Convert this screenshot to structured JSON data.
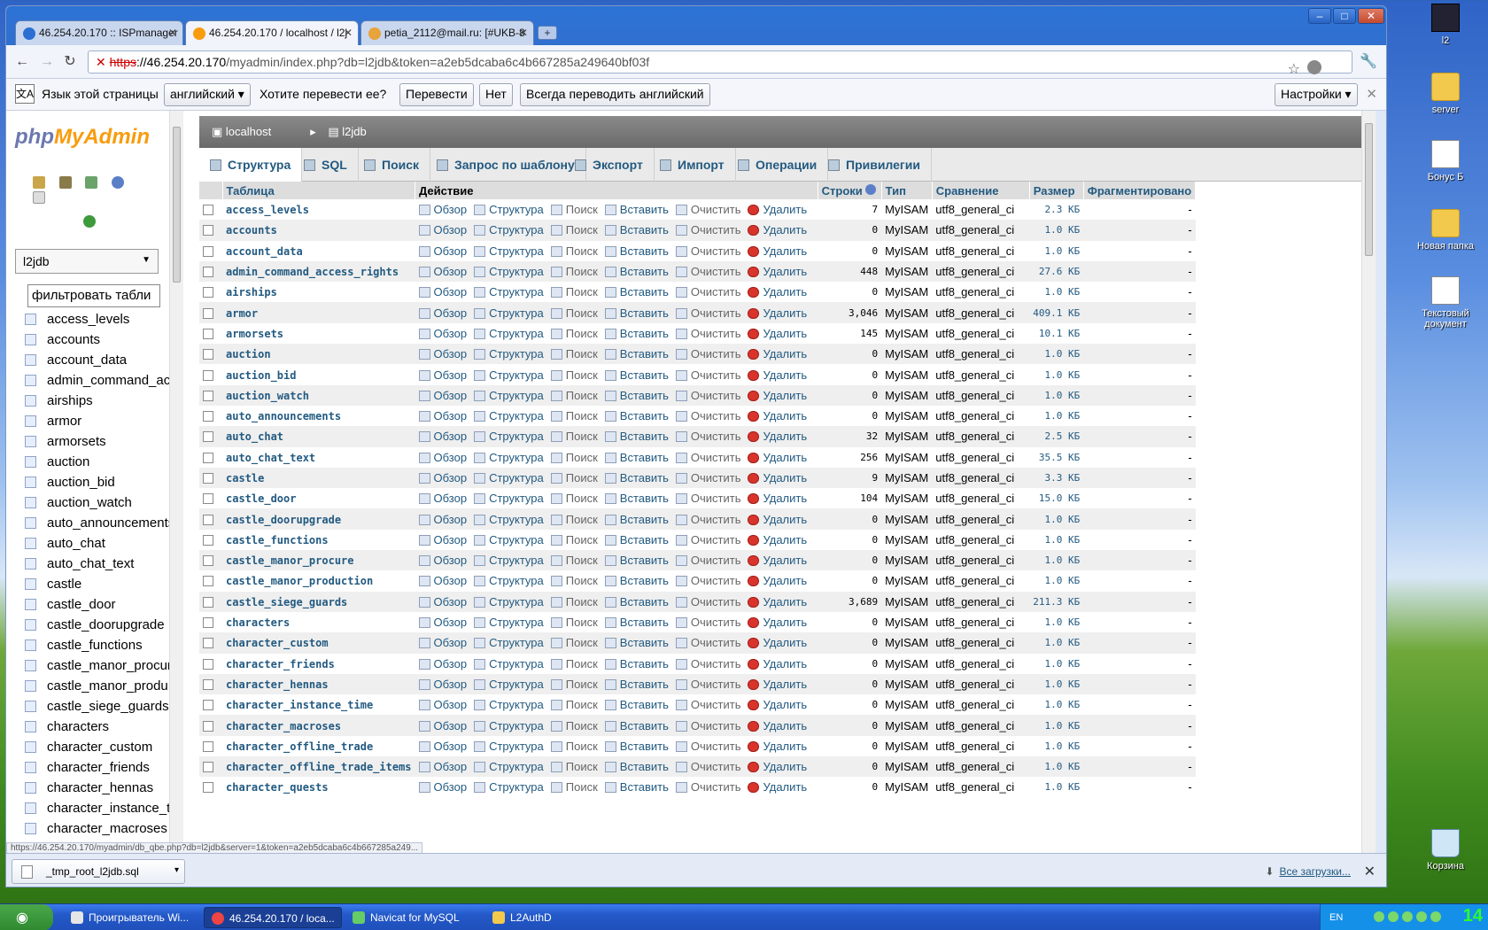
{
  "desktop": {
    "icons": [
      {
        "label": "l2",
        "icon": "l2-app-icon"
      },
      {
        "label": "server",
        "icon": "folder-icon"
      },
      {
        "label": "Бонус Б",
        "icon": "text-document-icon"
      },
      {
        "label": "Новая папка",
        "icon": "folder-icon"
      },
      {
        "label": "Текстовый документ",
        "icon": "text-document-icon"
      },
      {
        "label": "Корзина",
        "icon": "recycle-bin-icon"
      }
    ]
  },
  "browser": {
    "tabs": [
      {
        "title": "46.254.20.170 :: ISPmanager"
      },
      {
        "title": "46.254.20.170 / localhost / l2j"
      },
      {
        "title": "petia_2112@mail.ru: [#UKB-8"
      }
    ],
    "new_tab": "+",
    "url": {
      "scheme": "https",
      "host": "://46.254.20.170",
      "path": "/myadmin/index.php?db=l2jdb&token=a2eb5dcaba6c4b667285a249640bf03f"
    },
    "translate": {
      "page_lang_label": "Язык этой страницы",
      "lang_value": "английский",
      "question": "Хотите перевести ее?",
      "translate_btn": "Перевести",
      "no_btn": "Нет",
      "always_btn": "Всегда переводить английский",
      "settings_btn": "Настройки"
    },
    "status_url": "https://46.254.20.170/myadmin/db_qbe.php?db=l2jdb&server=1&token=a2eb5dcaba6c4b667285a249...",
    "download": {
      "file": "_tmp_root_l2jdb.sql",
      "all_link": "Все загрузки..."
    }
  },
  "pma": {
    "logo_php": "php",
    "logo_myadmin": "MyAdmin",
    "db_select": "l2jdb",
    "filter_placeholder": "фильтровать табли",
    "breadcrumb": {
      "server": "localhost",
      "db": "l2jdb"
    },
    "tabs": [
      {
        "label": "Структура",
        "icon": "structure-icon"
      },
      {
        "label": "SQL",
        "icon": "sql-icon"
      },
      {
        "label": "Поиск",
        "icon": "search-icon"
      },
      {
        "label": "Запрос по шаблону",
        "icon": "query-icon"
      },
      {
        "label": "Экспорт",
        "icon": "export-icon"
      },
      {
        "label": "Импорт",
        "icon": "import-icon"
      },
      {
        "label": "Операции",
        "icon": "operations-icon"
      },
      {
        "label": "Привилегии",
        "icon": "privileges-icon"
      }
    ],
    "headers": {
      "table": "Таблица",
      "action": "Действие",
      "rows": "Строки",
      "type": "Тип",
      "collation": "Сравнение",
      "size": "Размер",
      "overhead": "Фрагментировано"
    },
    "actions": {
      "browse": "Обзор",
      "structure": "Структура",
      "search": "Поиск",
      "insert": "Вставить",
      "empty": "Очистить",
      "drop": "Удалить"
    },
    "sidebar_tables": [
      "access_levels",
      "accounts",
      "account_data",
      "admin_command_ac",
      "airships",
      "armor",
      "armorsets",
      "auction",
      "auction_bid",
      "auction_watch",
      "auto_announcements",
      "auto_chat",
      "auto_chat_text",
      "castle",
      "castle_door",
      "castle_doorupgrade",
      "castle_functions",
      "castle_manor_procur",
      "castle_manor_produ",
      "castle_siege_guards",
      "characters",
      "character_custom",
      "character_friends",
      "character_hennas",
      "character_instance_t",
      "character_macroses"
    ],
    "rows": [
      {
        "name": "access_levels",
        "rows": "7",
        "type": "MyISAM",
        "coll": "utf8_general_ci",
        "size": "2.3",
        "unit": "КБ",
        "over": "-"
      },
      {
        "name": "accounts",
        "rows": "0",
        "type": "MyISAM",
        "coll": "utf8_general_ci",
        "size": "1.0",
        "unit": "КБ",
        "over": "-"
      },
      {
        "name": "account_data",
        "rows": "0",
        "type": "MyISAM",
        "coll": "utf8_general_ci",
        "size": "1.0",
        "unit": "КБ",
        "over": "-"
      },
      {
        "name": "admin_command_access_rights",
        "rows": "448",
        "type": "MyISAM",
        "coll": "utf8_general_ci",
        "size": "27.6",
        "unit": "КБ",
        "over": "-"
      },
      {
        "name": "airships",
        "rows": "0",
        "type": "MyISAM",
        "coll": "utf8_general_ci",
        "size": "1.0",
        "unit": "КБ",
        "over": "-"
      },
      {
        "name": "armor",
        "rows": "3,046",
        "type": "MyISAM",
        "coll": "utf8_general_ci",
        "size": "409.1",
        "unit": "КБ",
        "over": "-"
      },
      {
        "name": "armorsets",
        "rows": "145",
        "type": "MyISAM",
        "coll": "utf8_general_ci",
        "size": "10.1",
        "unit": "КБ",
        "over": "-"
      },
      {
        "name": "auction",
        "rows": "0",
        "type": "MyISAM",
        "coll": "utf8_general_ci",
        "size": "1.0",
        "unit": "КБ",
        "over": "-"
      },
      {
        "name": "auction_bid",
        "rows": "0",
        "type": "MyISAM",
        "coll": "utf8_general_ci",
        "size": "1.0",
        "unit": "КБ",
        "over": "-"
      },
      {
        "name": "auction_watch",
        "rows": "0",
        "type": "MyISAM",
        "coll": "utf8_general_ci",
        "size": "1.0",
        "unit": "КБ",
        "over": "-"
      },
      {
        "name": "auto_announcements",
        "rows": "0",
        "type": "MyISAM",
        "coll": "utf8_general_ci",
        "size": "1.0",
        "unit": "КБ",
        "over": "-"
      },
      {
        "name": "auto_chat",
        "rows": "32",
        "type": "MyISAM",
        "coll": "utf8_general_ci",
        "size": "2.5",
        "unit": "КБ",
        "over": "-"
      },
      {
        "name": "auto_chat_text",
        "rows": "256",
        "type": "MyISAM",
        "coll": "utf8_general_ci",
        "size": "35.5",
        "unit": "КБ",
        "over": "-"
      },
      {
        "name": "castle",
        "rows": "9",
        "type": "MyISAM",
        "coll": "utf8_general_ci",
        "size": "3.3",
        "unit": "КБ",
        "over": "-"
      },
      {
        "name": "castle_door",
        "rows": "104",
        "type": "MyISAM",
        "coll": "utf8_general_ci",
        "size": "15.0",
        "unit": "КБ",
        "over": "-"
      },
      {
        "name": "castle_doorupgrade",
        "rows": "0",
        "type": "MyISAM",
        "coll": "utf8_general_ci",
        "size": "1.0",
        "unit": "КБ",
        "over": "-"
      },
      {
        "name": "castle_functions",
        "rows": "0",
        "type": "MyISAM",
        "coll": "utf8_general_ci",
        "size": "1.0",
        "unit": "КБ",
        "over": "-"
      },
      {
        "name": "castle_manor_procure",
        "rows": "0",
        "type": "MyISAM",
        "coll": "utf8_general_ci",
        "size": "1.0",
        "unit": "КБ",
        "over": "-"
      },
      {
        "name": "castle_manor_production",
        "rows": "0",
        "type": "MyISAM",
        "coll": "utf8_general_ci",
        "size": "1.0",
        "unit": "КБ",
        "over": "-"
      },
      {
        "name": "castle_siege_guards",
        "rows": "3,689",
        "type": "MyISAM",
        "coll": "utf8_general_ci",
        "size": "211.3",
        "unit": "КБ",
        "over": "-"
      },
      {
        "name": "characters",
        "rows": "0",
        "type": "MyISAM",
        "coll": "utf8_general_ci",
        "size": "1.0",
        "unit": "КБ",
        "over": "-"
      },
      {
        "name": "character_custom",
        "rows": "0",
        "type": "MyISAM",
        "coll": "utf8_general_ci",
        "size": "1.0",
        "unit": "КБ",
        "over": "-"
      },
      {
        "name": "character_friends",
        "rows": "0",
        "type": "MyISAM",
        "coll": "utf8_general_ci",
        "size": "1.0",
        "unit": "КБ",
        "over": "-"
      },
      {
        "name": "character_hennas",
        "rows": "0",
        "type": "MyISAM",
        "coll": "utf8_general_ci",
        "size": "1.0",
        "unit": "КБ",
        "over": "-"
      },
      {
        "name": "character_instance_time",
        "rows": "0",
        "type": "MyISAM",
        "coll": "utf8_general_ci",
        "size": "1.0",
        "unit": "КБ",
        "over": "-"
      },
      {
        "name": "character_macroses",
        "rows": "0",
        "type": "MyISAM",
        "coll": "utf8_general_ci",
        "size": "1.0",
        "unit": "КБ",
        "over": "-"
      },
      {
        "name": "character_offline_trade",
        "rows": "0",
        "type": "MyISAM",
        "coll": "utf8_general_ci",
        "size": "1.0",
        "unit": "КБ",
        "over": "-"
      },
      {
        "name": "character_offline_trade_items",
        "rows": "0",
        "type": "MyISAM",
        "coll": "utf8_general_ci",
        "size": "1.0",
        "unit": "КБ",
        "over": "-"
      },
      {
        "name": "character_quests",
        "rows": "0",
        "type": "MyISAM",
        "coll": "utf8_general_ci",
        "size": "1.0",
        "unit": "КБ",
        "over": "-"
      }
    ]
  },
  "taskbar": {
    "start": "",
    "tasks": [
      {
        "label": "Проигрыватель Wi..."
      },
      {
        "label": "46.254.20.170 / loca..."
      },
      {
        "label": "Navicat for MySQL"
      },
      {
        "label": "L2AuthD"
      }
    ],
    "lang": "EN",
    "clock": "14"
  }
}
